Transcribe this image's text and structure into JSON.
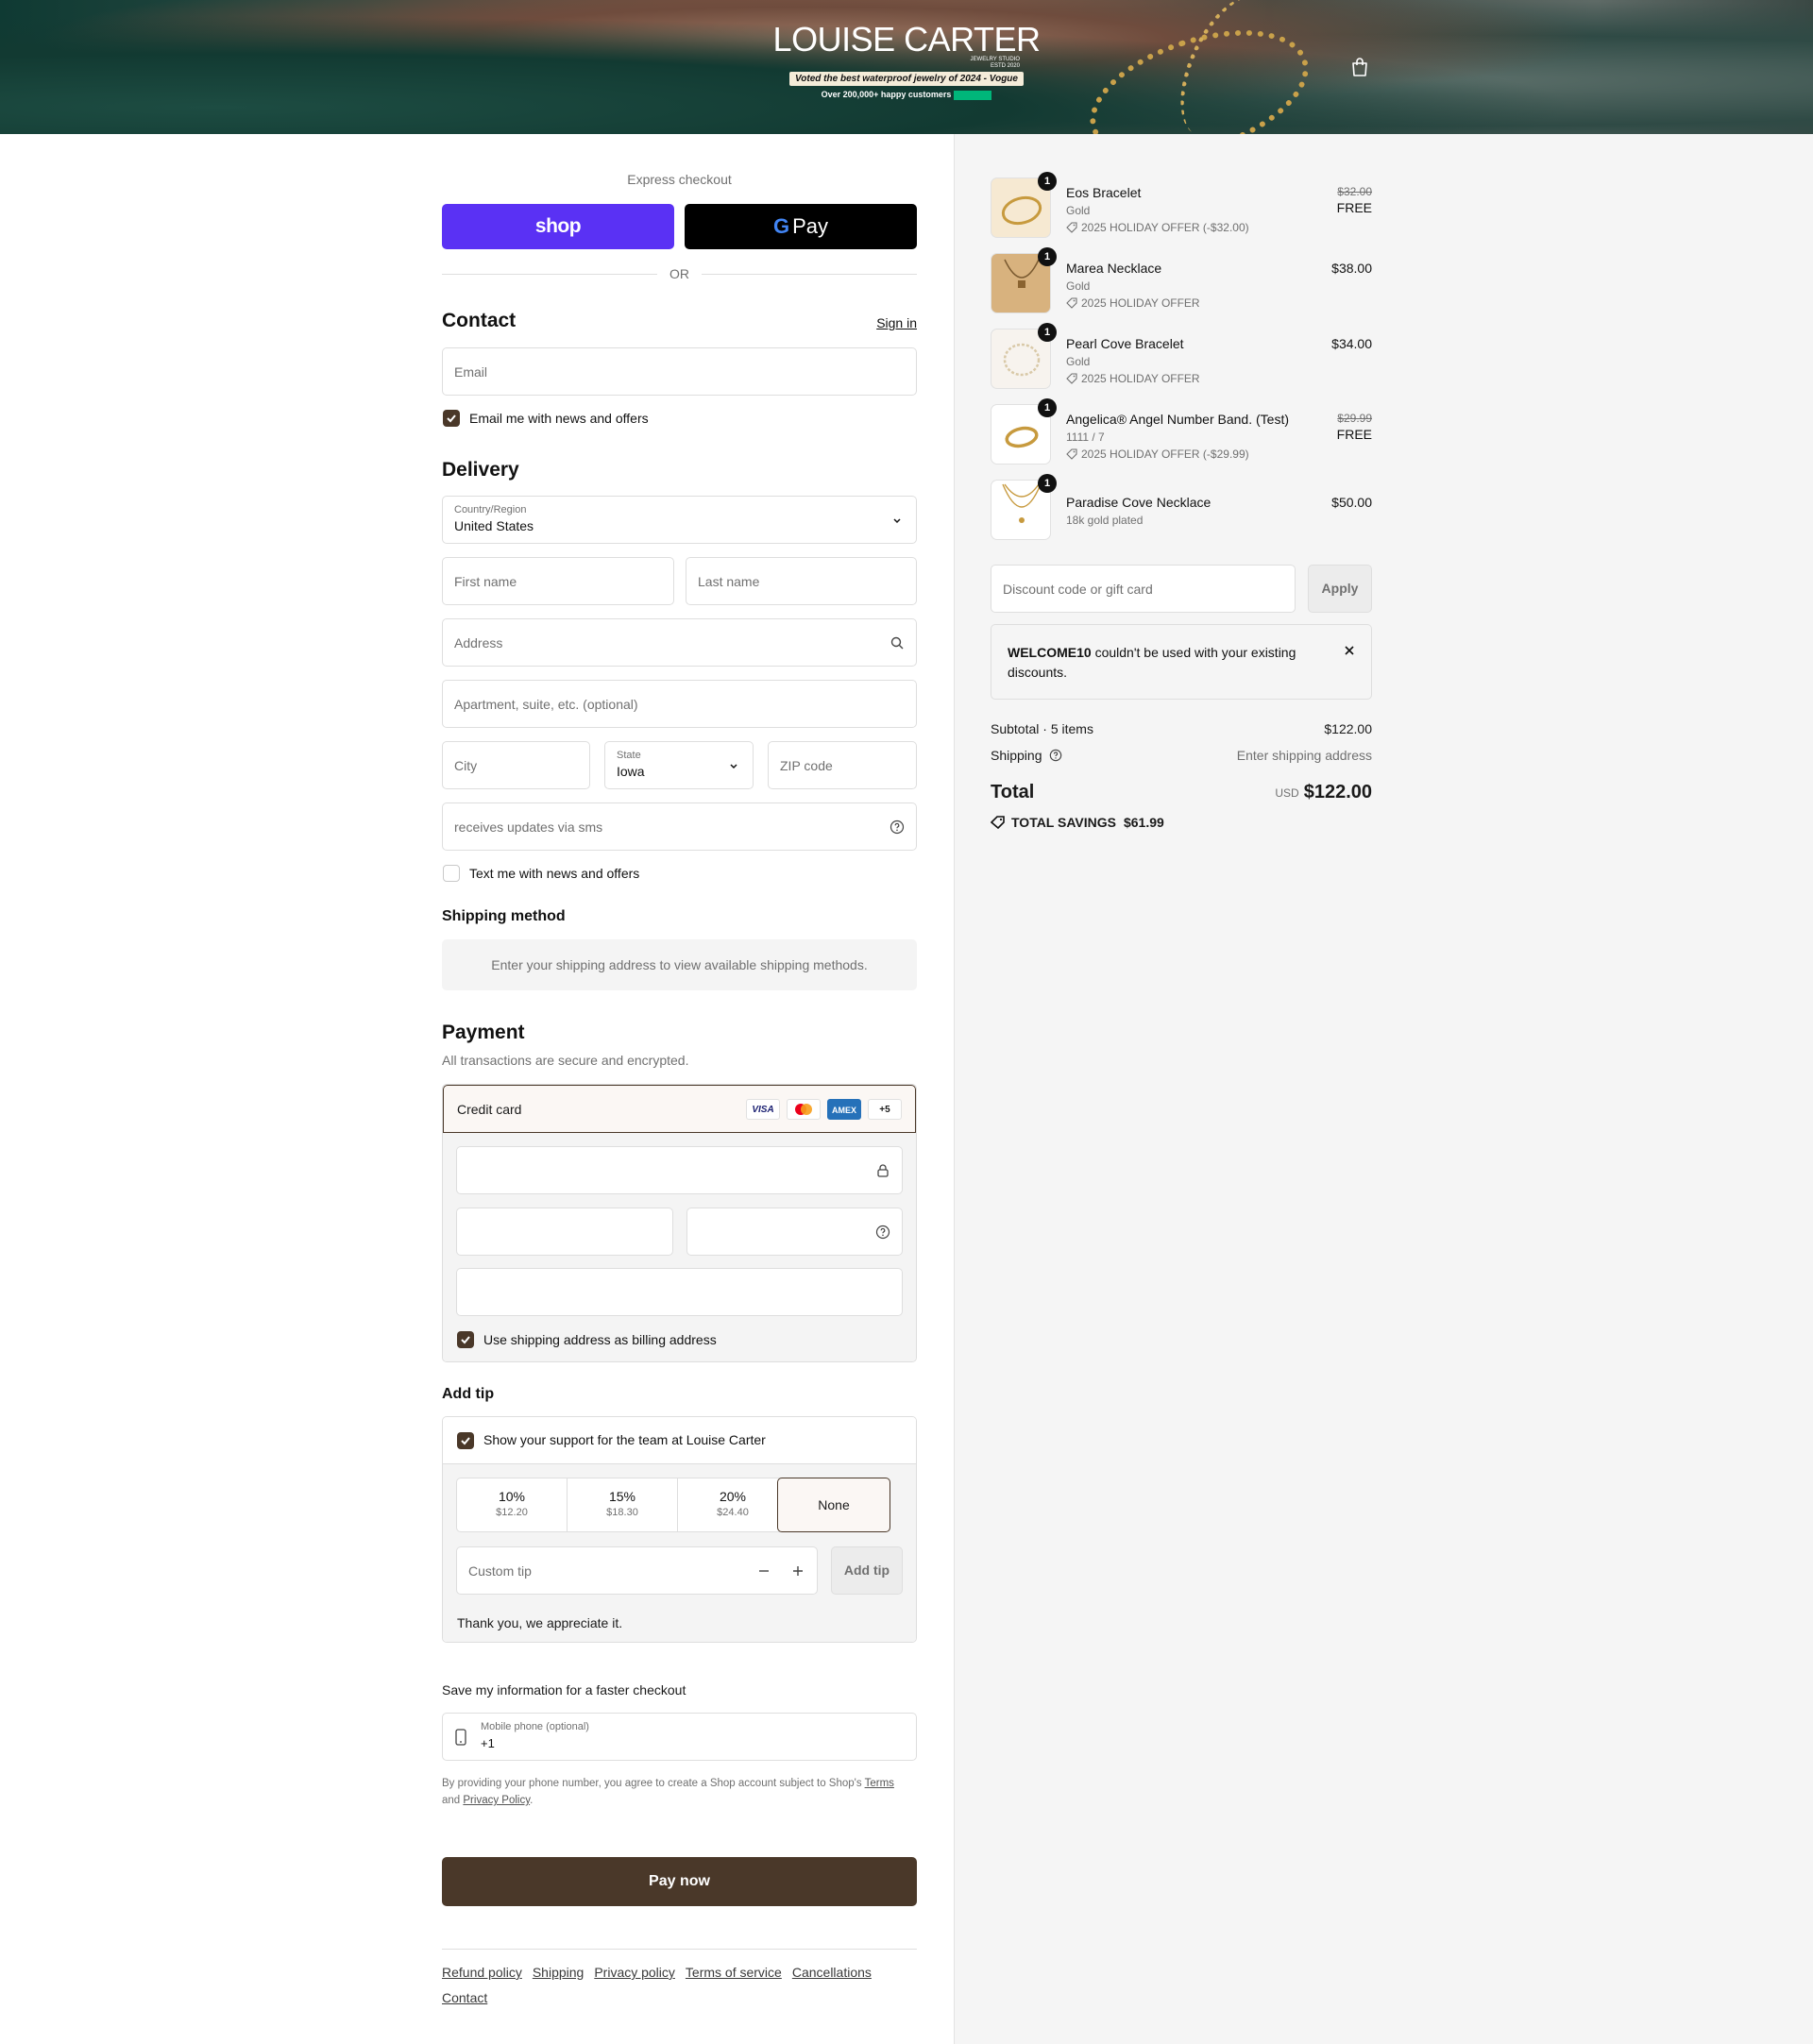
{
  "header": {
    "brand": "LOUISE CARTER",
    "brand_sub_1": "JEWELRY STUDIO",
    "brand_sub_2": "ESTD 2020",
    "badge": "Voted the best waterproof jewelry of 2024 - Vogue",
    "happy": "Over 200,000+ happy customers",
    "cart_icon": "shopping-bag-icon"
  },
  "express": {
    "label": "Express checkout",
    "shop_label": "shop",
    "gpay_g": "G",
    "gpay_label": "Pay",
    "or": "OR"
  },
  "contact": {
    "title": "Contact",
    "signin": "Sign in",
    "email_placeholder": "Email",
    "email_news": "Email me with news and offers",
    "email_news_checked": true
  },
  "delivery": {
    "title": "Delivery",
    "country_label": "Country/Region",
    "country_value": "United States",
    "first_name_placeholder": "First name",
    "last_name_placeholder": "Last name",
    "address_placeholder": "Address",
    "apartment_placeholder": "Apartment, suite, etc. (optional)",
    "city_placeholder": "City",
    "state_label": "State",
    "state_value": "Iowa",
    "zip_placeholder": "ZIP code",
    "sms_placeholder": "receives updates via sms",
    "text_news": "Text me with news and offers",
    "text_news_checked": false
  },
  "shipping_method": {
    "title": "Shipping method",
    "message": "Enter your shipping address to view available shipping methods."
  },
  "payment": {
    "title": "Payment",
    "subtitle": "All transactions are secure and encrypted.",
    "method": "Credit card",
    "cards": [
      "VISA",
      "MC",
      "AMEX",
      "+5"
    ],
    "billing_same": "Use shipping address as billing address",
    "billing_same_checked": true
  },
  "tip": {
    "title": "Add tip",
    "support": "Show your support for the team at Louise Carter",
    "options": [
      {
        "pct": "10%",
        "amount": "$12.20"
      },
      {
        "pct": "15%",
        "amount": "$18.30"
      },
      {
        "pct": "20%",
        "amount": "$24.40"
      }
    ],
    "none": "None",
    "custom_placeholder": "Custom tip",
    "add_button": "Add tip",
    "thanks": "Thank you, we appreciate it."
  },
  "save_info": {
    "title": "Save my information for a faster checkout",
    "phone_label": "Mobile phone (optional)",
    "phone_value": "+1",
    "legal_1": "By providing your phone number, you agree to create a Shop account subject to Shop's ",
    "legal_terms": "Terms",
    "legal_2": "and ",
    "legal_privacy": "Privacy Policy",
    "legal_3": "."
  },
  "pay_now": "Pay now",
  "footer": [
    "Refund policy",
    "Shipping",
    "Privacy policy",
    "Terms of service",
    "Cancellations",
    "Contact"
  ],
  "order": {
    "items": [
      {
        "qty": "1",
        "name": "Eos Bracelet",
        "variant": "Gold",
        "offer": "2025 HOLIDAY OFFER (-$32.00)",
        "original": "$32.00",
        "price": "FREE"
      },
      {
        "qty": "1",
        "name": "Marea Necklace",
        "variant": "Gold",
        "offer": "2025 HOLIDAY OFFER",
        "price": "$38.00"
      },
      {
        "qty": "1",
        "name": "Pearl Cove Bracelet",
        "variant": "Gold",
        "offer": "2025 HOLIDAY OFFER",
        "price": "$34.00"
      },
      {
        "qty": "1",
        "name": "Angelica® Angel Number Band. (Test)",
        "variant": "1111 / 7",
        "offer": "2025 HOLIDAY OFFER (-$29.99)",
        "original": "$29.99",
        "price": "FREE"
      },
      {
        "qty": "1",
        "name": "Paradise Cove Necklace",
        "variant": "18k gold plated",
        "price": "$50.00"
      }
    ],
    "discount_placeholder": "Discount code or gift card",
    "apply": "Apply",
    "notice_code": "WELCOME10",
    "notice_text": " couldn't be used with your existing discounts.",
    "subtotal_label": "Subtotal · 5 items",
    "subtotal_value": "$122.00",
    "shipping_label": "Shipping",
    "shipping_value": "Enter shipping address",
    "total_label": "Total",
    "currency": "USD",
    "total_value": "$122.00",
    "savings_label": "TOTAL SAVINGS",
    "savings_value": "$61.99"
  },
  "colors": {
    "accent": "#4a3829",
    "shop_purple": "#5a31f4",
    "panel_bg": "#f5f5f5"
  }
}
